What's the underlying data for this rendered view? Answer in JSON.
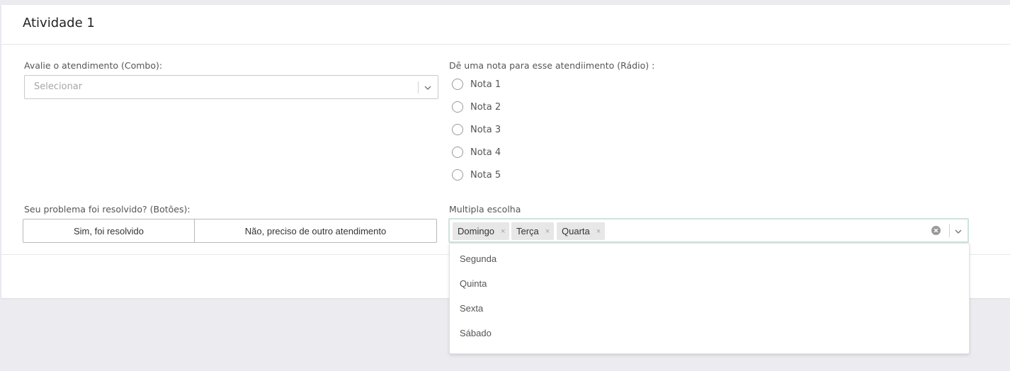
{
  "card": {
    "title": "Atividade 1"
  },
  "combo": {
    "label": "Avalie o atendimento (Combo):",
    "placeholder": "Selecionar"
  },
  "radio": {
    "label": "Dê uma nota para esse atendiimento (Rádio) :",
    "options": [
      "Nota 1",
      "Nota 2",
      "Nota 3",
      "Nota 4",
      "Nota 5"
    ]
  },
  "buttons": {
    "label": "Seu problema foi resolvido? (Botões):",
    "yes": "Sim, foi resolvido",
    "no": "Não, preciso de outro atendimento"
  },
  "multi": {
    "label": "Multipla escolha",
    "selected": [
      "Domingo",
      "Terça",
      "Quarta"
    ],
    "remove_glyph": "×",
    "options": [
      "Segunda",
      "Quinta",
      "Sexta",
      "Sábado"
    ]
  },
  "icons": {
    "chevron": "chevron-down-icon",
    "clear": "clear-circle-icon",
    "remove": "close-icon"
  },
  "colors": {
    "page_bg": "#ecebf0",
    "card_bg": "#ffffff",
    "focus_border": "#cfe2db",
    "tag_bg": "#e7e7e7"
  }
}
